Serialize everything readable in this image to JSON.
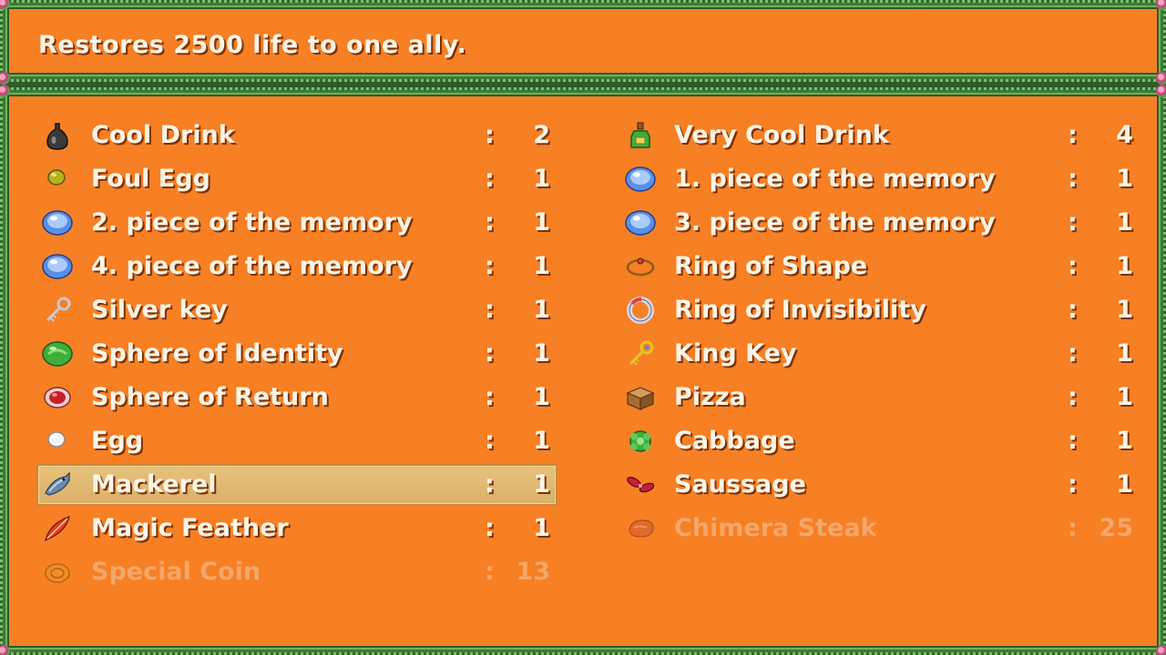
{
  "help": {
    "text": "Restores 2500 life to one ally."
  },
  "colors": {
    "panel": "#f77f24",
    "border": "#3d7a37",
    "text": "#fff4e6",
    "text_disabled": "#f3a76a",
    "selection": "#e7c27c"
  },
  "items": [
    {
      "name": "Cool Drink",
      "colon": ":",
      "qty": "2",
      "icon": "dark-potion-icon",
      "enabled": true,
      "selected": false
    },
    {
      "name": "Very Cool Drink",
      "colon": ":",
      "qty": "4",
      "icon": "green-bottle-icon",
      "enabled": true,
      "selected": false
    },
    {
      "name": "Foul Egg",
      "colon": ":",
      "qty": "1",
      "icon": "foul-egg-icon",
      "enabled": true,
      "selected": false
    },
    {
      "name": "1. piece of the memory",
      "colon": ":",
      "qty": "1",
      "icon": "memory-orb-icon",
      "enabled": true,
      "selected": false
    },
    {
      "name": "2. piece of the memory",
      "colon": ":",
      "qty": "1",
      "icon": "memory-orb-icon",
      "enabled": true,
      "selected": false
    },
    {
      "name": "3. piece of the memory",
      "colon": ":",
      "qty": "1",
      "icon": "memory-orb-icon",
      "enabled": true,
      "selected": false
    },
    {
      "name": "4. piece of the memory",
      "colon": ":",
      "qty": "1",
      "icon": "memory-orb-icon",
      "enabled": true,
      "selected": false
    },
    {
      "name": "Ring of Shape",
      "colon": ":",
      "qty": "1",
      "icon": "ring-icon",
      "enabled": true,
      "selected": false
    },
    {
      "name": "Silver key",
      "colon": ":",
      "qty": "1",
      "icon": "silver-key-icon",
      "enabled": true,
      "selected": false
    },
    {
      "name": "Ring of Invisibility",
      "colon": ":",
      "qty": "1",
      "icon": "invisibility-ring-icon",
      "enabled": true,
      "selected": false
    },
    {
      "name": "Sphere of Identity",
      "colon": ":",
      "qty": "1",
      "icon": "green-sphere-icon",
      "enabled": true,
      "selected": false
    },
    {
      "name": "King Key",
      "colon": ":",
      "qty": "1",
      "icon": "gold-key-icon",
      "enabled": true,
      "selected": false
    },
    {
      "name": "Sphere of Return",
      "colon": ":",
      "qty": "1",
      "icon": "red-sphere-icon",
      "enabled": true,
      "selected": false
    },
    {
      "name": "Pizza",
      "colon": ":",
      "qty": "1",
      "icon": "pizza-box-icon",
      "enabled": true,
      "selected": false
    },
    {
      "name": "Egg",
      "colon": ":",
      "qty": "1",
      "icon": "egg-icon",
      "enabled": true,
      "selected": false
    },
    {
      "name": "Cabbage",
      "colon": ":",
      "qty": "1",
      "icon": "cabbage-icon",
      "enabled": true,
      "selected": false
    },
    {
      "name": "Mackerel",
      "colon": ":",
      "qty": "1",
      "icon": "fish-icon",
      "enabled": true,
      "selected": true
    },
    {
      "name": "Saussage",
      "colon": ":",
      "qty": "1",
      "icon": "sausage-icon",
      "enabled": true,
      "selected": false
    },
    {
      "name": "Magic Feather",
      "colon": ":",
      "qty": "1",
      "icon": "feather-icon",
      "enabled": true,
      "selected": false
    },
    {
      "name": "Chimera Steak",
      "colon": ":",
      "qty": "25",
      "icon": "steak-icon",
      "enabled": false,
      "selected": false
    },
    {
      "name": "Special Coin",
      "colon": ":",
      "qty": "13",
      "icon": "coin-icon",
      "enabled": false,
      "selected": false
    }
  ]
}
